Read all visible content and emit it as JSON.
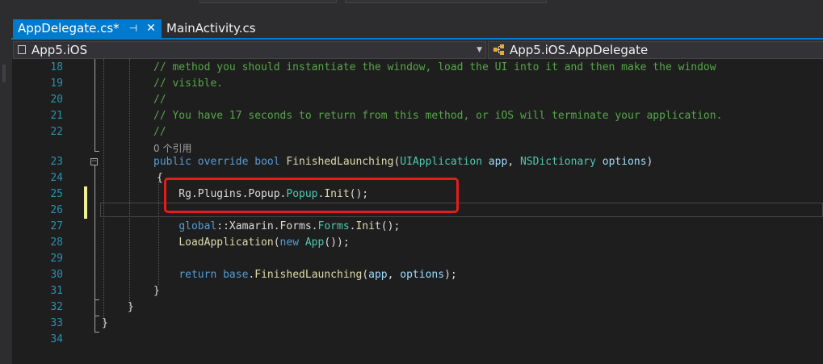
{
  "tabs": [
    {
      "label": "AppDelegate.cs*",
      "active": true
    },
    {
      "label": "MainActivity.cs",
      "active": false
    }
  ],
  "icons": {
    "pin": "pin-icon",
    "close": "close-icon",
    "dropdown": "chevron-down-icon",
    "project": "project-icon",
    "class": "class-icon"
  },
  "glyphs": {
    "pin": "⊣",
    "close": "✕",
    "dropdown": "▼",
    "collapse": "−"
  },
  "nav": {
    "project": "App5.iOS",
    "class": "App5.iOS.AppDelegate"
  },
  "colors": {
    "accent": "#007acc",
    "background": "#1e1e1e",
    "highlight_box": "#e51c1c",
    "modified_marker": "#efef91",
    "line_number": "#2b91af",
    "comment": "#57a64a",
    "keyword": "#569cd6",
    "type": "#4ec9b0"
  },
  "editor": {
    "lines": [
      {
        "n": "18",
        "tokens": [
          {
            "t": "// method you should instantiate the window, load the UI into it and then make the window",
            "c": "comment"
          }
        ]
      },
      {
        "n": "19",
        "tokens": [
          {
            "t": "// visible.",
            "c": "comment"
          }
        ]
      },
      {
        "n": "20",
        "tokens": [
          {
            "t": "//",
            "c": "comment"
          }
        ]
      },
      {
        "n": "21",
        "tokens": [
          {
            "t": "// You have 17 seconds to return from this method, or iOS will terminate your application.",
            "c": "comment"
          }
        ]
      },
      {
        "n": "22",
        "tokens": [
          {
            "t": "//",
            "c": "comment"
          }
        ]
      },
      {
        "n": "",
        "tokens": [
          {
            "t": "0 个引用",
            "c": "ref"
          }
        ]
      },
      {
        "n": "23",
        "tokens": [
          {
            "t": "public",
            "c": "kw"
          },
          {
            "t": " ",
            "c": ""
          },
          {
            "t": "override",
            "c": "kw"
          },
          {
            "t": " ",
            "c": ""
          },
          {
            "t": "bool",
            "c": "kw"
          },
          {
            "t": " ",
            "c": ""
          },
          {
            "t": "FinishedLaunching",
            "c": "meth"
          },
          {
            "t": "(",
            "c": ""
          },
          {
            "t": "UIApplication",
            "c": "type"
          },
          {
            "t": " ",
            "c": ""
          },
          {
            "t": "app",
            "c": "param"
          },
          {
            "t": ", ",
            "c": ""
          },
          {
            "t": "NSDictionary",
            "c": "type"
          },
          {
            "t": " ",
            "c": ""
          },
          {
            "t": "options",
            "c": "param"
          },
          {
            "t": ")",
            "c": ""
          }
        ]
      },
      {
        "n": "24",
        "tokens": [
          {
            "t": "{",
            "c": ""
          }
        ]
      },
      {
        "n": "25",
        "tokens": [
          {
            "t": "    Rg.Plugins.Popup.",
            "c": ""
          },
          {
            "t": "Popup",
            "c": "type"
          },
          {
            "t": ".",
            "c": ""
          },
          {
            "t": "Init",
            "c": "meth"
          },
          {
            "t": "();",
            "c": ""
          }
        ]
      },
      {
        "n": "26",
        "tokens": []
      },
      {
        "n": "27",
        "tokens": [
          {
            "t": "    ",
            "c": ""
          },
          {
            "t": "global",
            "c": "kw"
          },
          {
            "t": "::Xamarin.Forms.",
            "c": ""
          },
          {
            "t": "Forms",
            "c": "type"
          },
          {
            "t": ".",
            "c": ""
          },
          {
            "t": "Init",
            "c": "meth"
          },
          {
            "t": "();",
            "c": ""
          }
        ]
      },
      {
        "n": "28",
        "tokens": [
          {
            "t": "    ",
            "c": ""
          },
          {
            "t": "LoadApplication",
            "c": "meth"
          },
          {
            "t": "(",
            "c": ""
          },
          {
            "t": "new",
            "c": "kw"
          },
          {
            "t": " ",
            "c": ""
          },
          {
            "t": "App",
            "c": "type"
          },
          {
            "t": "());",
            "c": ""
          }
        ]
      },
      {
        "n": "29",
        "tokens": []
      },
      {
        "n": "30",
        "tokens": [
          {
            "t": "    ",
            "c": ""
          },
          {
            "t": "return",
            "c": "kw"
          },
          {
            "t": " ",
            "c": ""
          },
          {
            "t": "base",
            "c": "kw"
          },
          {
            "t": ".",
            "c": ""
          },
          {
            "t": "FinishedLaunching",
            "c": "meth"
          },
          {
            "t": "(",
            "c": ""
          },
          {
            "t": "app",
            "c": "param"
          },
          {
            "t": ", ",
            "c": ""
          },
          {
            "t": "options",
            "c": "param"
          },
          {
            "t": ");",
            "c": ""
          }
        ]
      },
      {
        "n": "31",
        "tokens": [
          {
            "t": "}",
            "c": ""
          }
        ]
      },
      {
        "n": "32",
        "tokens": [
          {
            "t": "}",
            "c": ""
          }
        ]
      },
      {
        "n": "33",
        "tokens": [
          {
            "t": "}",
            "c": ""
          }
        ]
      },
      {
        "n": "34",
        "tokens": []
      }
    ]
  }
}
